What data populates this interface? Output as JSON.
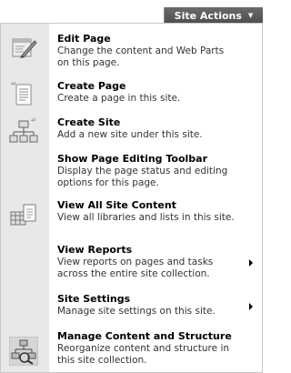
{
  "site_actions_button": {
    "label": "Site Actions"
  },
  "menu": {
    "items": [
      {
        "title": "Edit Page",
        "desc": [
          "Change the content and Web Parts",
          "on this page."
        ]
      },
      {
        "title": "Create Page",
        "desc": [
          "Create a page in this site."
        ]
      },
      {
        "title": "Create Site",
        "desc": [
          "Add a new site under this site."
        ]
      },
      {
        "title": "Show Page Editing Toolbar",
        "desc": [
          "Display the page status and editing",
          "options for this page."
        ]
      },
      {
        "title": "View All Site Content",
        "desc": [
          "View all libraries and lists in this site."
        ]
      },
      {
        "title": "View Reports",
        "desc": [
          "View reports on pages and tasks",
          "across the entire site collection."
        ]
      },
      {
        "title": "Site Settings",
        "desc": [
          "Manage site settings on this site."
        ]
      },
      {
        "title": "Manage Content and Structure",
        "desc": [
          "Reorganize content and structure in",
          "this site collection."
        ]
      }
    ]
  }
}
